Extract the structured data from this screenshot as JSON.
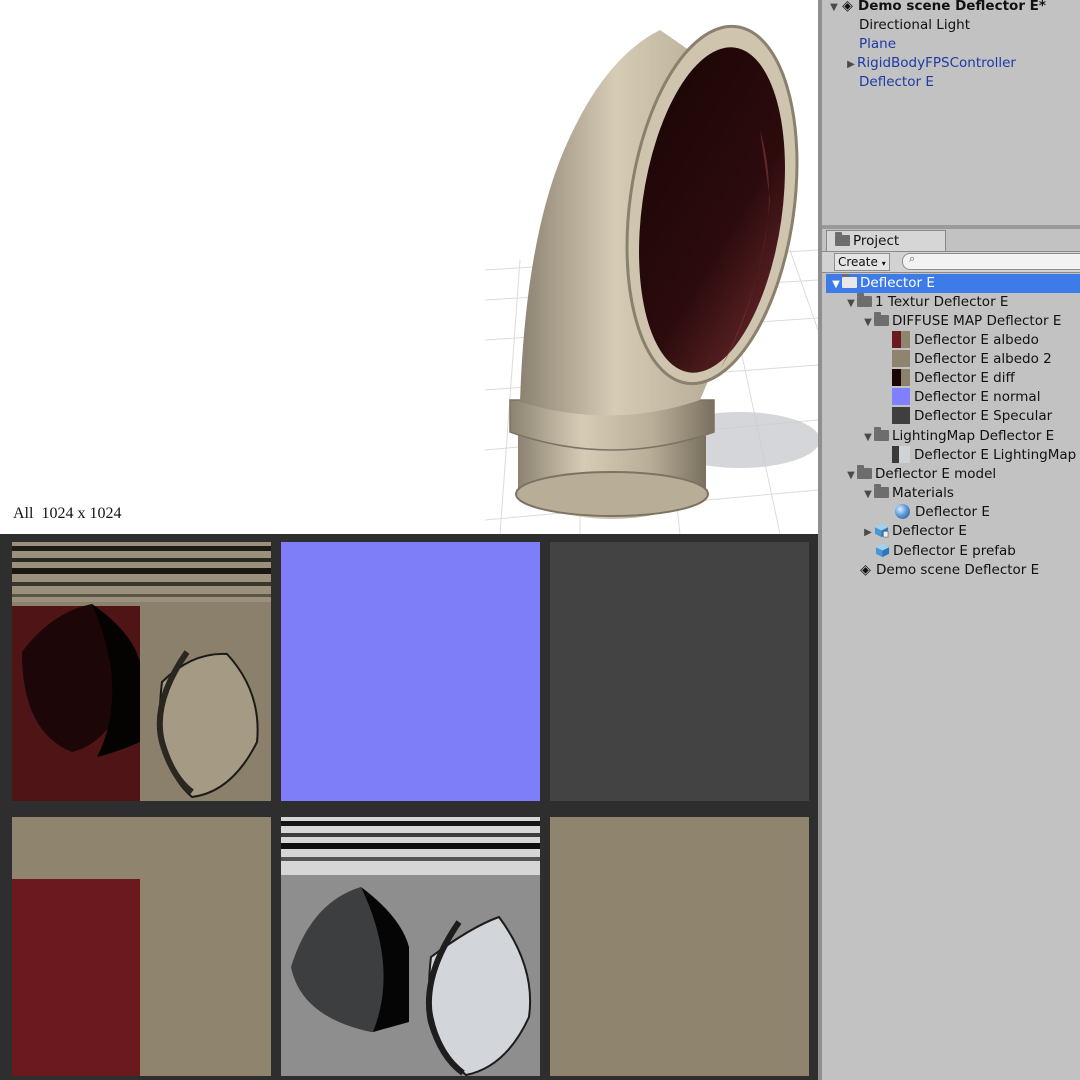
{
  "caption": "All  1024 x 1024",
  "hierarchy": {
    "scene_title": "Demo scene Deflector E*",
    "items": [
      "Directional Light",
      "Plane",
      "RigidBodyFPSController",
      "Deflector E"
    ]
  },
  "project": {
    "tab_label": "Project",
    "create_label": "Create",
    "search_placeholder": "",
    "tree": [
      "Deflector E",
      "1 Textur Deflector E",
      "DIFFUSE MAP Deflector E",
      "Deflector E albedo",
      "Deflector E albedo 2",
      "Deflector E diff",
      "Deflector E normal",
      "Deflector E Specular",
      "LightingMap Deflector E",
      "Deflector E LightingMap",
      "Deflector E model",
      "Materials",
      "Deflector E",
      "Deflector E",
      "Deflector E prefab",
      "Demo scene Deflector E"
    ]
  },
  "colors": {
    "selection": "#3d7be8",
    "panel_bg": "#c2c2c2",
    "albedo_dark_red": "#6a1a1e",
    "beige": "#8f846e",
    "normal_blue": "#7f7fff",
    "specular_gray": "#3f3f3f"
  }
}
